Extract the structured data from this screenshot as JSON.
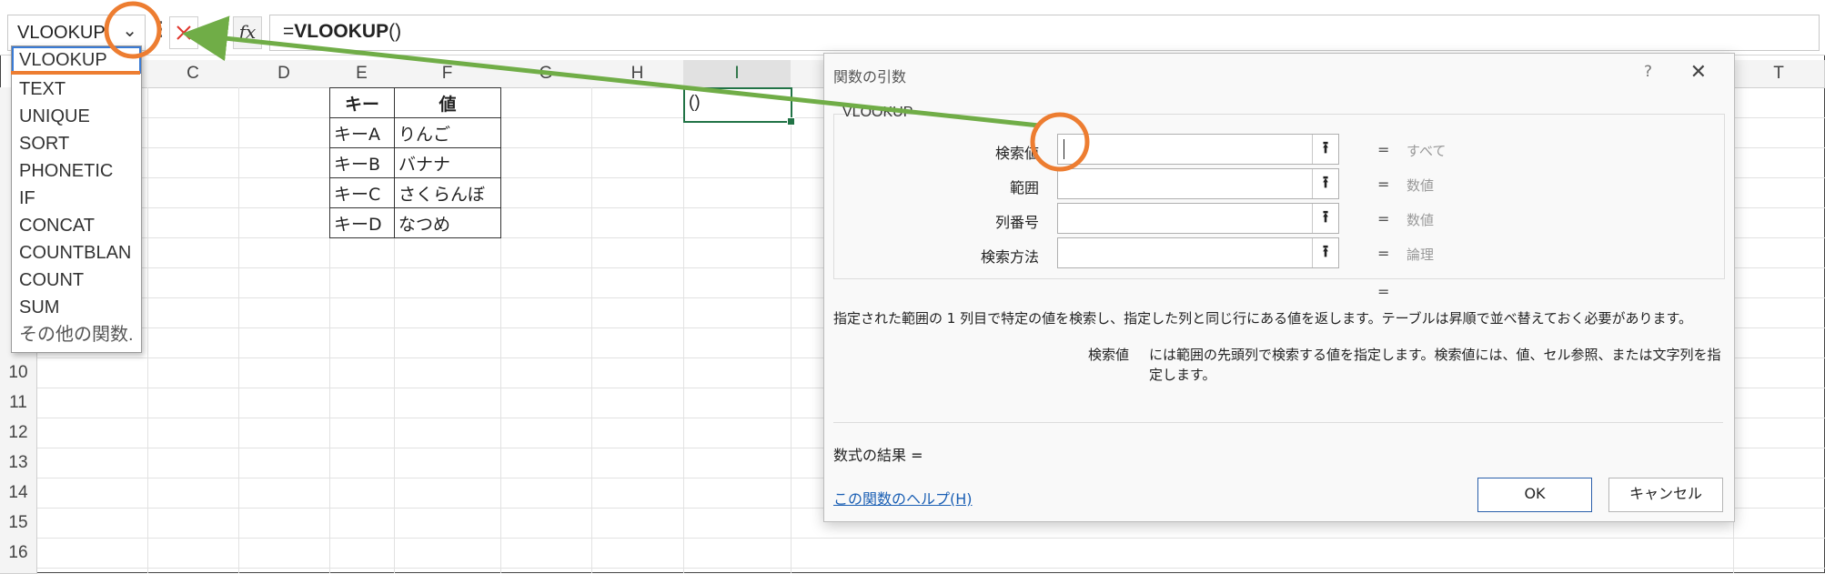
{
  "formula_bar": {
    "name_box": "VLOOKUP",
    "name_box_icon": "chevron-down-icon",
    "dots_icon": "more-vertical-icon",
    "cancel_icon": "close-icon",
    "enter_icon": "check-icon",
    "fx_label": "fx",
    "formula_prefix": "=",
    "formula_fn": "VLOOKUP",
    "formula_suffix": "()"
  },
  "dropdown": {
    "items": [
      "VLOOKUP",
      "TEXT",
      "UNIQUE",
      "SORT",
      "PHONETIC",
      "IF",
      "CONCAT",
      "COUNTBLAN",
      "COUNT",
      "SUM"
    ],
    "more": "その他の関数."
  },
  "grid": {
    "columns": [
      "C",
      "D",
      "E",
      "F",
      "G",
      "H",
      "I",
      "T"
    ],
    "rows": [
      "10",
      "11",
      "12",
      "13",
      "14",
      "15",
      "16"
    ],
    "active_cell_value": "()"
  },
  "table": {
    "headers": [
      "キー",
      "値"
    ],
    "rows": [
      [
        "キーA",
        "りんご"
      ],
      [
        "キーB",
        "バナナ"
      ],
      [
        "キーC",
        "さくらんぼ"
      ],
      [
        "キーD",
        "なつめ"
      ]
    ]
  },
  "dialog": {
    "title": "関数の引数",
    "help_char": "?",
    "close_char": "✕",
    "function_name": "VLOOKUP",
    "args": [
      {
        "label": "検索値",
        "hint": "すべて"
      },
      {
        "label": "範囲",
        "hint": "数値"
      },
      {
        "label": "列番号",
        "hint": "数値"
      },
      {
        "label": "検索方法",
        "hint": "論理"
      }
    ],
    "equals": "=",
    "description": "指定された範囲の 1 列目で特定の値を検索し、指定した列と同じ行にある値を返します。テーブルは昇順で並べ替えておく必要があります。",
    "arg_desc_label": "検索値",
    "arg_desc_text": "には範囲の先頭列で検索する値を指定します。検索値には、値、セル参照、または文字列を指定します。",
    "result_label": "数式の結果 =",
    "help_link": "この関数のヘルプ(H)",
    "ok": "OK",
    "cancel": "キャンセル"
  },
  "colors": {
    "annotation_orange": "#ed7d31",
    "annotation_green": "#70ad47",
    "excel_green": "#217346",
    "link_blue": "#1a5fb4"
  }
}
